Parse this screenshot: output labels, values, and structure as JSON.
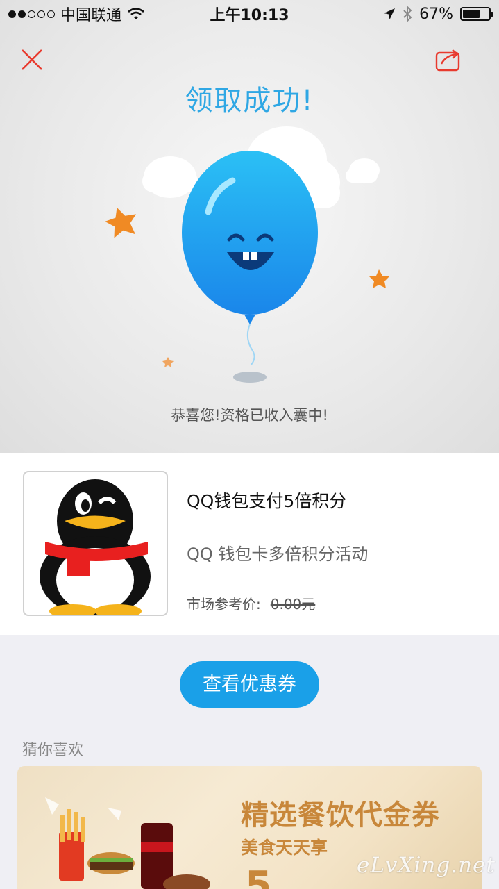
{
  "status_bar": {
    "carrier": "中国联通",
    "time": "上午10:13",
    "battery": "67%",
    "battery_level": 0.67,
    "signal_bars": 2
  },
  "header": {
    "close_icon": "close-icon",
    "share_icon": "share-icon",
    "accent_color": "#e83a2e"
  },
  "hero": {
    "title": "领取成功!",
    "title_color": "#2fa7e4",
    "message": "恭喜您!资格已收入囊中!"
  },
  "product": {
    "name": "QQ钱包支付5倍积分",
    "description": "QQ 钱包卡多倍积分活动",
    "price_label": "市场参考价:",
    "price_value": "0.00元",
    "thumbnail_icon": "qq-penguin-icon"
  },
  "actions": {
    "view_coupon_label": "查看优惠券",
    "button_color": "#1aa0e8"
  },
  "recommend": {
    "section_label": "猜你喜欢",
    "banner": {
      "title": "精选餐饮代金券",
      "subtitle": "美食天天享",
      "big_text": "5"
    }
  },
  "watermark": "eLvXing.net"
}
